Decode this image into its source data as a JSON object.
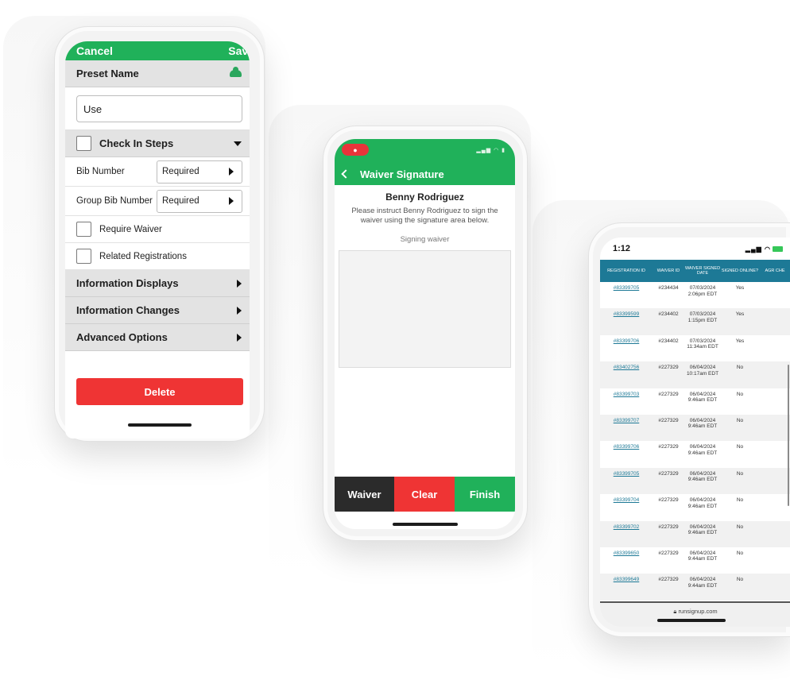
{
  "phone1": {
    "cancel": "Cancel",
    "save": "Save",
    "preset_name_label": "Preset Name",
    "preset_name_value": "Use",
    "check_in_steps": "Check In Steps",
    "bib_number_label": "Bib Number",
    "bib_number_value": "Required",
    "group_bib_label": "Group Bib Number",
    "group_bib_value": "Required",
    "require_waiver": "Require Waiver",
    "related_registrations": "Related Registrations",
    "information_displays": "Information Displays",
    "information_changes": "Information Changes",
    "advanced_options": "Advanced Options",
    "delete": "Delete"
  },
  "phone2": {
    "title": "Waiver Signature",
    "name": "Benny Rodriguez",
    "instruction": "Please instruct Benny Rodriguez to sign the waiver using the signature area below.",
    "signing": "Signing waiver",
    "buttons": {
      "waiver": "Waiver",
      "clear": "Clear",
      "finish": "Finish"
    },
    "colors": {
      "green": "#20b15a",
      "red": "#ef3434",
      "dark": "#2b2b2b"
    }
  },
  "phone3": {
    "time": "1:12",
    "headers": [
      "REGISTRATION ID",
      "WAIVER ID",
      "WAIVER SIGNED DATE",
      "SIGNED ONLINE?",
      "AGR CHE"
    ],
    "rows": [
      [
        "#83399705",
        "#234434",
        "07/03/2024 2:06pm EDT",
        "Yes"
      ],
      [
        "#83399599",
        "#234402",
        "07/03/2024 1:15pm EDT",
        "Yes"
      ],
      [
        "#83399706",
        "#234402",
        "07/03/2024 11:34am EDT",
        "Yes"
      ],
      [
        "#83402756",
        "#227329",
        "06/04/2024 10:17am EDT",
        "No"
      ],
      [
        "#83399703",
        "#227329",
        "06/04/2024 9:46am EDT",
        "No"
      ],
      [
        "#83399707",
        "#227329",
        "06/04/2024 9:46am EDT",
        "No"
      ],
      [
        "#83399706",
        "#227329",
        "06/04/2024 9:46am EDT",
        "No"
      ],
      [
        "#83399705",
        "#227329",
        "06/04/2024 9:46am EDT",
        "No"
      ],
      [
        "#83399704",
        "#227329",
        "06/04/2024 9:46am EDT",
        "No"
      ],
      [
        "#83399702",
        "#227329",
        "06/04/2024 9:46am EDT",
        "No"
      ],
      [
        "#83399650",
        "#227329",
        "06/04/2024 9:44am EDT",
        "No"
      ],
      [
        "#83399649",
        "#227329",
        "06/04/2024 9:44am EDT",
        "No"
      ]
    ],
    "url": "runsignup.com",
    "header_color": "#1d7996"
  }
}
